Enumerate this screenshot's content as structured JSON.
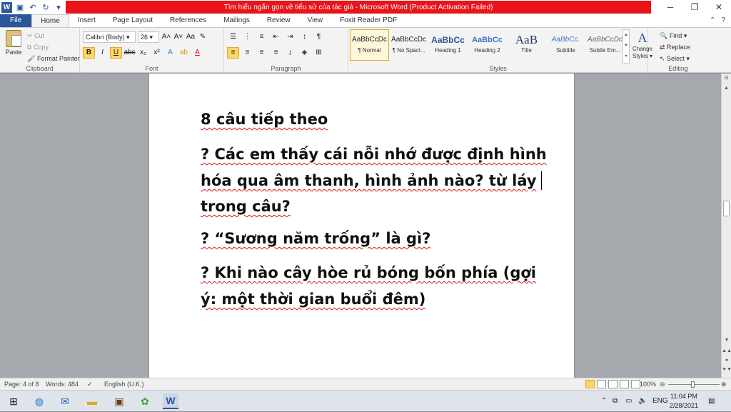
{
  "window": {
    "title": "Tìm hiểu ngắn gọn về tiểu sử của tác giả  -  Microsoft Word (Product Activation Failed)",
    "minimize": "─",
    "restore": "❐",
    "close": "✕"
  },
  "tabs": [
    "File",
    "Home",
    "Insert",
    "Page Layout",
    "References",
    "Mailings",
    "Review",
    "View",
    "Foxit Reader PDF"
  ],
  "ribbon": {
    "clipboard": {
      "paste": "Paste",
      "cut": "Cut",
      "copy": "Copy",
      "format_painter": "Format Painter",
      "label": "Clipboard"
    },
    "font": {
      "font_name": "Calibri (Body)",
      "font_size": "26",
      "label": "Font"
    },
    "paragraph": {
      "label": "Paragraph"
    },
    "styles": {
      "label": "Styles",
      "items": [
        {
          "sample": "AaBbCcDc",
          "name": "¶ Normal"
        },
        {
          "sample": "AaBbCcDc",
          "name": "¶ No Spaci..."
        },
        {
          "sample": "AaBbCc",
          "name": "Heading 1"
        },
        {
          "sample": "AaBbCc",
          "name": "Heading 2"
        },
        {
          "sample": "AaB",
          "name": "Title"
        },
        {
          "sample": "AaBbCc.",
          "name": "Subtitle"
        },
        {
          "sample": "AaBbCcDc",
          "name": "Subtle Em..."
        }
      ],
      "change_styles_line1": "Change",
      "change_styles_line2": "Styles ▾"
    },
    "editing": {
      "find": "Find ▾",
      "replace": "Replace",
      "select": "Select ▾",
      "label": "Editing"
    }
  },
  "document": {
    "lines": [
      "8 câu tiếp theo",
      "? Các em thấy cái nỗi nhớ được định hình",
      "hóa qua âm thanh, hình ảnh nào? từ láy",
      "trong câu?",
      "? “Sương năm trống” là gì?",
      "? Khi nào cây hòe rủ bóng bốn phía (gợi",
      "ý: một thời gian buổi đêm)"
    ]
  },
  "status": {
    "page": "Page: 4 of 8",
    "words": "Words: 484",
    "language": "English (U.K.)",
    "zoom": "100%"
  },
  "taskbar": {
    "ime": "ENG",
    "time": "11:04 PM",
    "date": "2/28/2021"
  },
  "colors": {
    "title_bar_warning": "#e8141a",
    "word_blue": "#2b579a",
    "spellcheck_underline": "#d11"
  }
}
